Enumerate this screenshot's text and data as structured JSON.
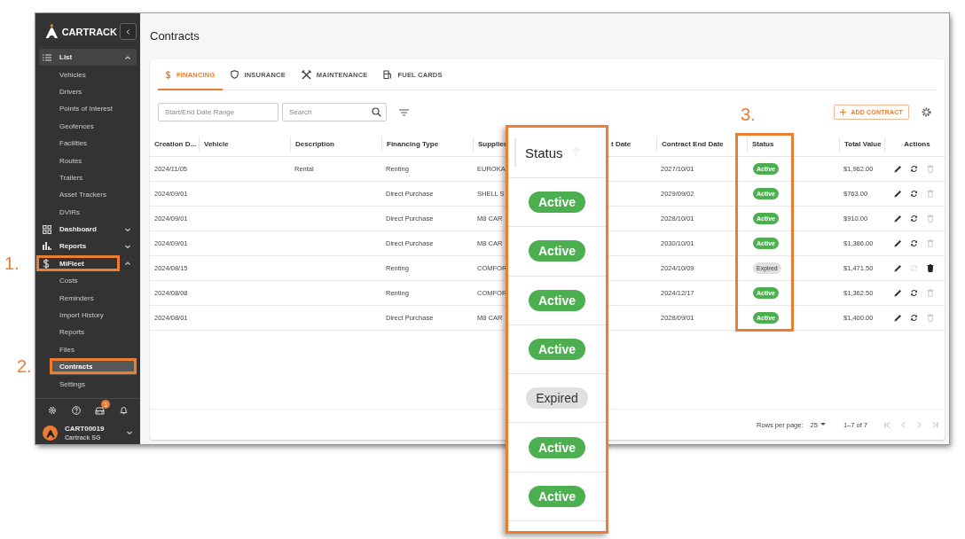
{
  "sidebar": {
    "logo": "CARTRACK",
    "sections": [
      {
        "label": "List",
        "expanded": true,
        "children": [
          {
            "label": "Vehicles",
            "selected": false
          },
          {
            "label": "Drivers",
            "selected": false
          },
          {
            "label": "Points of Interest",
            "selected": false
          },
          {
            "label": "Geofences",
            "selected": false
          },
          {
            "label": "Facilities",
            "selected": false
          },
          {
            "label": "Routes",
            "selected": false
          },
          {
            "label": "Trailers",
            "selected": false
          },
          {
            "label": "Asset Trackers",
            "selected": false
          },
          {
            "label": "DVIRs",
            "selected": false
          }
        ]
      },
      {
        "label": "Dashboard",
        "expanded": false
      },
      {
        "label": "Reports",
        "expanded": false
      },
      {
        "label": "MiFleet",
        "expanded": true,
        "children": [
          {
            "label": "Costs",
            "selected": false
          },
          {
            "label": "Reminders",
            "selected": false
          },
          {
            "label": "Import History",
            "selected": false
          },
          {
            "label": "Reports",
            "selected": false
          },
          {
            "label": "Files",
            "selected": false
          },
          {
            "label": "Contracts",
            "selected": true
          },
          {
            "label": "Settings",
            "selected": false
          }
        ]
      }
    ],
    "notification_count": "1",
    "user": {
      "name": "CART00019",
      "org": "Cartrack SG"
    }
  },
  "page_title": "Contracts",
  "tabs": [
    {
      "label": "FINANCING",
      "selected": true
    },
    {
      "label": "INSURANCE",
      "selected": false
    },
    {
      "label": "MAINTENANCE",
      "selected": false
    },
    {
      "label": "FUEL CARDS",
      "selected": false
    }
  ],
  "filters": {
    "date_placeholder": "Start/End Date Range",
    "search_placeholder": "Search"
  },
  "add_button": "ADD CONTRACT",
  "table": {
    "columns": [
      "Creation D...",
      "Vehicle",
      "Description",
      "Financing Type",
      "Supplier",
      "t Date",
      "Contract End Date",
      "Status",
      "Total Value",
      "Actions"
    ],
    "rows": [
      {
        "created": "2024/11/05",
        "description": "Rental",
        "financing_type": "Renting",
        "supplier": "EUROKA",
        "end_date": "2027/10/01",
        "status": {
          "label": "Active",
          "kind": "active"
        },
        "total": "$1,962.00",
        "renew_disabled": false,
        "delete_disabled": true
      },
      {
        "created": "2024/09/01",
        "financing_type": "Direct Purchase",
        "supplier": "SHELL S",
        "end_date": "2029/09/02",
        "status": {
          "label": "Active",
          "kind": "active"
        },
        "total": "$763.00",
        "renew_disabled": false,
        "delete_disabled": true
      },
      {
        "created": "2024/09/01",
        "financing_type": "Direct Purchase",
        "supplier": "M8 CAR",
        "end_date": "2028/10/01",
        "status": {
          "label": "Active",
          "kind": "active"
        },
        "total": "$910.00",
        "renew_disabled": false,
        "delete_disabled": true
      },
      {
        "created": "2024/09/01",
        "financing_type": "Direct Purchase",
        "supplier": "M8 CAR",
        "end_date": "2030/10/01",
        "status": {
          "label": "Active",
          "kind": "active"
        },
        "total": "$1,386.00",
        "renew_disabled": false,
        "delete_disabled": true
      },
      {
        "created": "2024/08/15",
        "financing_type": "Renting",
        "supplier": "COMFOR",
        "end_date": "2024/10/09",
        "status": {
          "label": "Expired",
          "kind": "expired"
        },
        "total": "$1,471.50",
        "renew_disabled": true,
        "delete_disabled": false
      },
      {
        "created": "2024/08/08",
        "financing_type": "Renting",
        "supplier": "COMFOR",
        "end_date": "2024/12/17",
        "status": {
          "label": "Active",
          "kind": "active"
        },
        "total": "$1,362.50",
        "renew_disabled": false,
        "delete_disabled": true
      },
      {
        "created": "2024/08/01",
        "financing_type": "Direct Purchase",
        "supplier": "M8 CAR",
        "end_date": "2028/09/01",
        "status": {
          "label": "Active",
          "kind": "active"
        },
        "total": "$1,400.00",
        "renew_disabled": false,
        "delete_disabled": true
      }
    ]
  },
  "pagination": {
    "rows_per_page_label": "Rows per page:",
    "rows_per_page": "25",
    "range": "1–7 of 7"
  },
  "annotations": [
    {
      "label": "1."
    },
    {
      "label": "2."
    },
    {
      "label": "3."
    }
  ],
  "callout": {
    "header": "Status",
    "rows": [
      {
        "label": "Active",
        "kind": "active"
      },
      {
        "label": "Active",
        "kind": "active"
      },
      {
        "label": "Active",
        "kind": "active"
      },
      {
        "label": "Active",
        "kind": "active"
      },
      {
        "label": "Expired",
        "kind": "expired"
      },
      {
        "label": "Active",
        "kind": "active"
      },
      {
        "label": "Active",
        "kind": "active"
      }
    ]
  }
}
